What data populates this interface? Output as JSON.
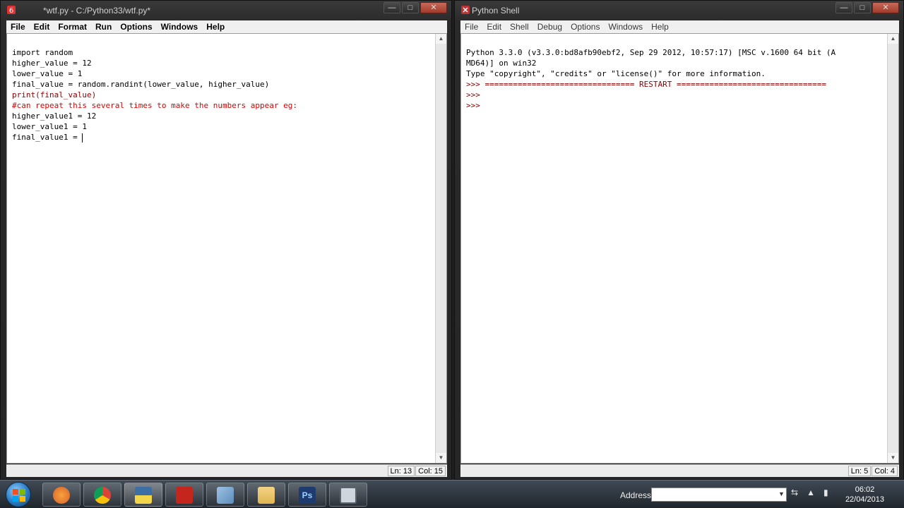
{
  "editor_window": {
    "title": "*wtf.py - C:/Python33/wtf.py*",
    "menu": [
      "File",
      "Edit",
      "Format",
      "Run",
      "Options",
      "Windows",
      "Help"
    ],
    "code_lines": [
      "import random",
      "",
      "higher_value = 12",
      "lower_value = 1",
      "final_value = random.randint(lower_value, higher_value)",
      "print(final_value)",
      "",
      "",
      "#can repeat this several times to make the numbers appear eg:",
      "",
      "higher_value1 = 12",
      "lower_value1 = 1",
      "final_value1 = "
    ],
    "status": {
      "line": "Ln: 13",
      "col": "Col: 15"
    }
  },
  "shell_window": {
    "title": "Python Shell",
    "menu": [
      "File",
      "Edit",
      "Shell",
      "Debug",
      "Options",
      "Windows",
      "Help"
    ],
    "output_lines": [
      "Python 3.3.0 (v3.3.0:bd8afb90ebf2, Sep 29 2012, 10:57:17) [MSC v.1600 64 bit (A",
      "MD64)] on win32",
      "Type \"copyright\", \"credits\" or \"license()\" for more information.",
      ">>> ================================ RESTART ================================",
      ">>> ",
      ">>> "
    ],
    "status": {
      "line": "Ln: 5",
      "col": "Col: 4"
    }
  },
  "window_controls": {
    "minimize": "—",
    "maximize": "□",
    "close": "✕"
  },
  "taskbar": {
    "apps": [
      {
        "name": "firefox-icon",
        "color": "#d9602b"
      },
      {
        "name": "chrome-icon",
        "color": "#e8b81a"
      },
      {
        "name": "python-idle-icon",
        "color": "#3d6fa5"
      },
      {
        "name": "acrobat-icon",
        "color": "#c4261d"
      },
      {
        "name": "notepad-icon",
        "color": "#5b8dbd"
      },
      {
        "name": "explorer-folder-icon",
        "color": "#e0b552"
      },
      {
        "name": "photoshop-icon",
        "color": "#1d3b6e"
      },
      {
        "name": "window-icon",
        "color": "#cfd6de"
      }
    ],
    "address_label": "Address",
    "address_value": "",
    "clock_time": "06:02",
    "clock_date": "22/04/2013"
  }
}
